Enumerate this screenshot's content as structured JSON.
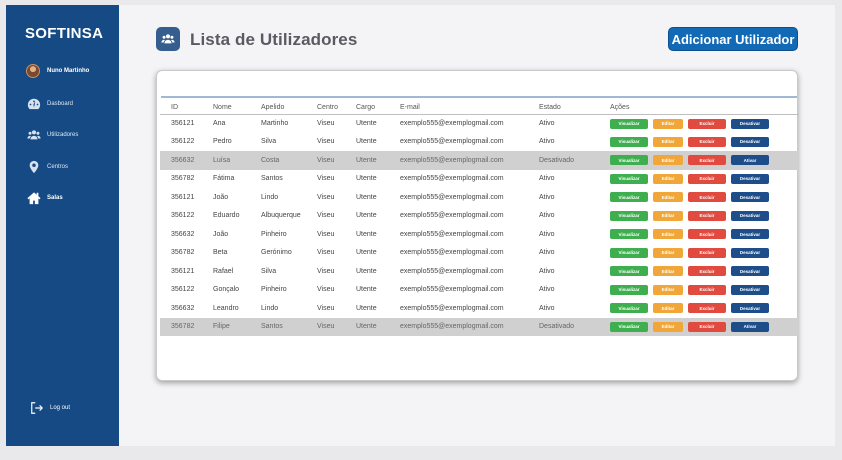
{
  "brand": "SOFTINSA",
  "user": {
    "name": "Nuno Martinho"
  },
  "nav": [
    {
      "label": "Dasboard",
      "icon": "gauge-icon"
    },
    {
      "label": "Utilizadores",
      "icon": "users-icon"
    },
    {
      "label": "Centros",
      "icon": "map-pin-icon"
    },
    {
      "label": "Salas",
      "icon": "home-icon"
    }
  ],
  "logout": "Log out",
  "page": {
    "title": "Lista de Utilizadores",
    "add_button": "Adicionar Utilizador"
  },
  "table": {
    "headers": [
      "ID",
      "Nome",
      "Apelido",
      "Centro",
      "Cargo",
      "E-mail",
      "Estado",
      "Ações"
    ],
    "rows": [
      [
        "356121",
        "Ana",
        "Martinho",
        "Viseu",
        "Utente",
        "exemplo555@exemplogmail.com",
        "Ativo"
      ],
      [
        "356122",
        "Pedro",
        "Silva",
        "Viseu",
        "Utente",
        "exemplo555@exemplogmail.com",
        "Ativo"
      ],
      [
        "356632",
        "Luísa",
        "Costa",
        "Viseu",
        "Utente",
        "exemplo555@exemplogmail.com",
        "Desativado"
      ],
      [
        "356782",
        "Fátima",
        "Santos",
        "Viseu",
        "Utente",
        "exemplo555@exemplogmail.com",
        "Ativo"
      ],
      [
        "356121",
        "João",
        "Lindo",
        "Viseu",
        "Utente",
        "exemplo555@exemplogmail.com",
        "Ativo"
      ],
      [
        "356122",
        "Eduardo",
        "Albuquerque",
        "Viseu",
        "Utente",
        "exemplo555@exemplogmail.com",
        "Ativo"
      ],
      [
        "356632",
        "João",
        "Pinheiro",
        "Viseu",
        "Utente",
        "exemplo555@exemplogmail.com",
        "Ativo"
      ],
      [
        "356782",
        "Beta",
        "Gerónimo",
        "Viseu",
        "Utente",
        "exemplo555@exemplogmail.com",
        "Ativo"
      ],
      [
        "356121",
        "Rafael",
        "Silva",
        "Viseu",
        "Utente",
        "exemplo555@exemplogmail.com",
        "Ativo"
      ],
      [
        "356122",
        "Gonçalo",
        "Pinheiro",
        "Viseu",
        "Utente",
        "exemplo555@exemplogmail.com",
        "Ativo"
      ],
      [
        "356632",
        "Leandro",
        "Lindo",
        "Viseu",
        "Utente",
        "exemplo555@exemplogmail.com",
        "Ativo"
      ],
      [
        "356782",
        "Filipe",
        "Santos",
        "Viseu",
        "Utente",
        "exemplo555@exemplogmail.com",
        "Desativado"
      ]
    ],
    "actions": {
      "view": "Visualizar",
      "edit": "Editar",
      "delete": "Excluir",
      "deactivate": "Desativar",
      "activate": "Ativar"
    },
    "inactive_status": "Desativado"
  },
  "colors": {
    "sidebar": "#164a85",
    "view": "#3fae4f",
    "edit": "#f0a639",
    "delete": "#e04a3f",
    "toggle": "#1d4e8a",
    "add_button": "#1269b6"
  }
}
